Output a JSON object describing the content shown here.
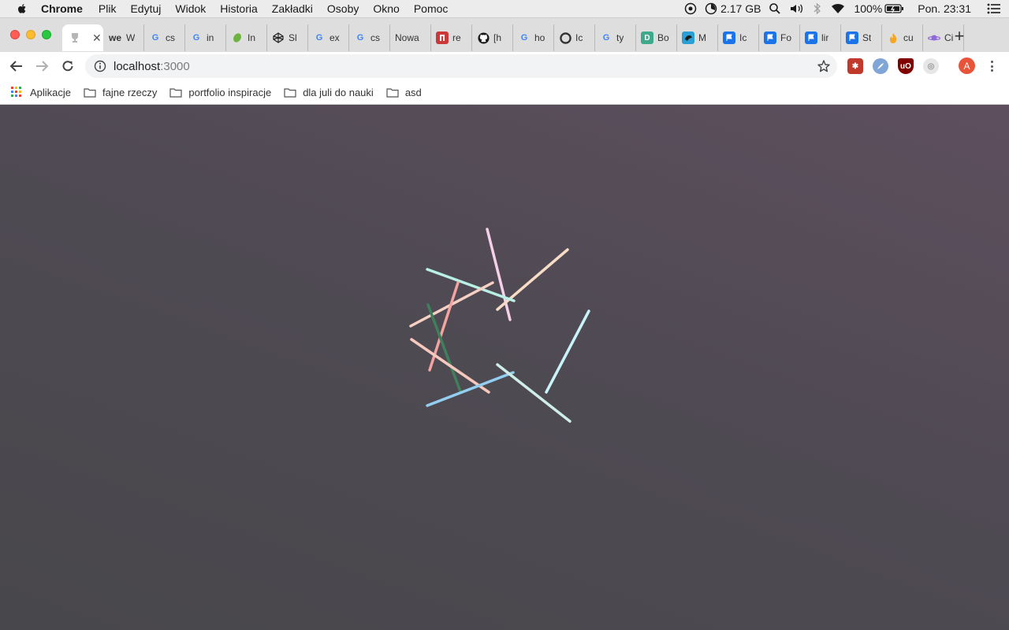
{
  "menubar": {
    "app_name": "Chrome",
    "items": [
      "Plik",
      "Edytuj",
      "Widok",
      "Historia",
      "Zakładki",
      "Osoby",
      "Okno",
      "Pomoc"
    ],
    "memory": "2.17 GB",
    "battery": "100%",
    "clock": "Pon. 23:31"
  },
  "tabs": [
    {
      "label": "",
      "favicon": "trophy-icon",
      "fav_color": "#9a9a9a",
      "active": true
    },
    {
      "label": "W",
      "favicon": "we",
      "fav_color": "#000000"
    },
    {
      "label": "cs",
      "favicon": "google-icon",
      "fav_color": "#4285f4"
    },
    {
      "label": "in",
      "favicon": "google-icon",
      "fav_color": "#4285f4"
    },
    {
      "label": "In",
      "favicon": "leaf-icon",
      "fav_color": "#6db33f"
    },
    {
      "label": "Sl",
      "favicon": "codepen-icon",
      "fav_color": "#222222"
    },
    {
      "label": "ex",
      "favicon": "google-icon",
      "fav_color": "#4285f4"
    },
    {
      "label": "cs",
      "favicon": "google-icon",
      "fav_color": "#4285f4"
    },
    {
      "label": "Nowa",
      "favicon": "",
      "fav_color": ""
    },
    {
      "label": "re",
      "favicon": "npm-icon",
      "fav_color": "#cb3837"
    },
    {
      "label": "[h",
      "favicon": "github-icon",
      "fav_color": "#181717"
    },
    {
      "label": "ho",
      "favicon": "google-icon",
      "fav_color": "#4285f4"
    },
    {
      "label": "Ic",
      "favicon": "circle-icon",
      "fav_color": "#333333"
    },
    {
      "label": "ty",
      "favicon": "google-icon",
      "fav_color": "#4285f4"
    },
    {
      "label": "Bo",
      "favicon": "d-icon",
      "fav_color": "#3fa98c"
    },
    {
      "label": "M",
      "favicon": "bird-icon",
      "fav_color": "#2a9fd6"
    },
    {
      "label": "Ic",
      "favicon": "flag-icon",
      "fav_color": "#1a73e8"
    },
    {
      "label": "Fo",
      "favicon": "flag-icon",
      "fav_color": "#1a73e8"
    },
    {
      "label": "lir",
      "favicon": "flag-icon",
      "fav_color": "#1a73e8"
    },
    {
      "label": "St",
      "favicon": "flag-icon",
      "fav_color": "#1a73e8"
    },
    {
      "label": "cu",
      "favicon": "fire-icon",
      "fav_color": "#f5a623"
    },
    {
      "label": "Ci",
      "favicon": "planet-icon",
      "fav_color": "#8e6ad8"
    }
  ],
  "toolbar": {
    "url_host": "localhost",
    "url_port": ":3000",
    "avatar_letter": "A"
  },
  "bookmarks": [
    {
      "label": "Aplikacje",
      "icon": "apps-grid-icon"
    },
    {
      "label": "fajne rzeczy",
      "icon": "folder-icon"
    },
    {
      "label": "portfolio inspiracje",
      "icon": "folder-icon"
    },
    {
      "label": "dla juli do nauki",
      "icon": "folder-icon"
    },
    {
      "label": "asd",
      "icon": "folder-icon"
    }
  ],
  "page": {
    "background_top": "#5e4f5e",
    "background_bottom": "#48474b",
    "lines": [
      {
        "color": "#f6cfe8"
      },
      {
        "color": "#f7dcc6"
      },
      {
        "color": "#b8f0e3"
      },
      {
        "color": "#f6d0c3"
      },
      {
        "color": "#f4a3a0"
      },
      {
        "color": "#3f7f5c"
      },
      {
        "color": "#f7c8bd"
      },
      {
        "color": "#93cdf0"
      },
      {
        "color": "#cfeee9"
      },
      {
        "color": "#c8f3f8"
      }
    ]
  }
}
